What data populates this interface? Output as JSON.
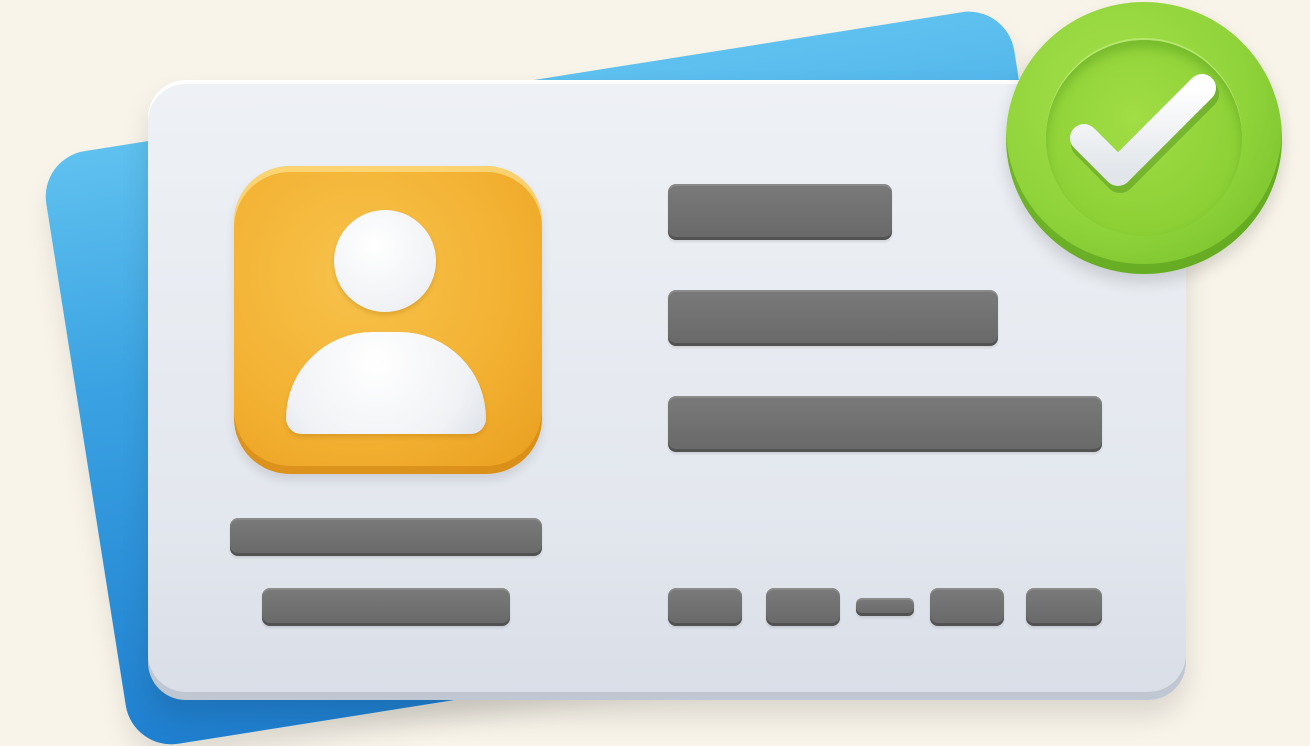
{
  "scene": {
    "background_color": "#f8f4ea",
    "cards": {
      "back_card_color": "#3aa2e2",
      "front_card_color": "#e6eaf0"
    },
    "avatar": {
      "icon": "user-profile-icon",
      "tile_color": "#f3b233",
      "figure_color": "#f0f2f5"
    },
    "badge": {
      "icon": "checkmark-icon",
      "color": "#8fd33a",
      "check_color": "#ffffff"
    },
    "placeholder_bar_color": "#6f6f6f"
  }
}
